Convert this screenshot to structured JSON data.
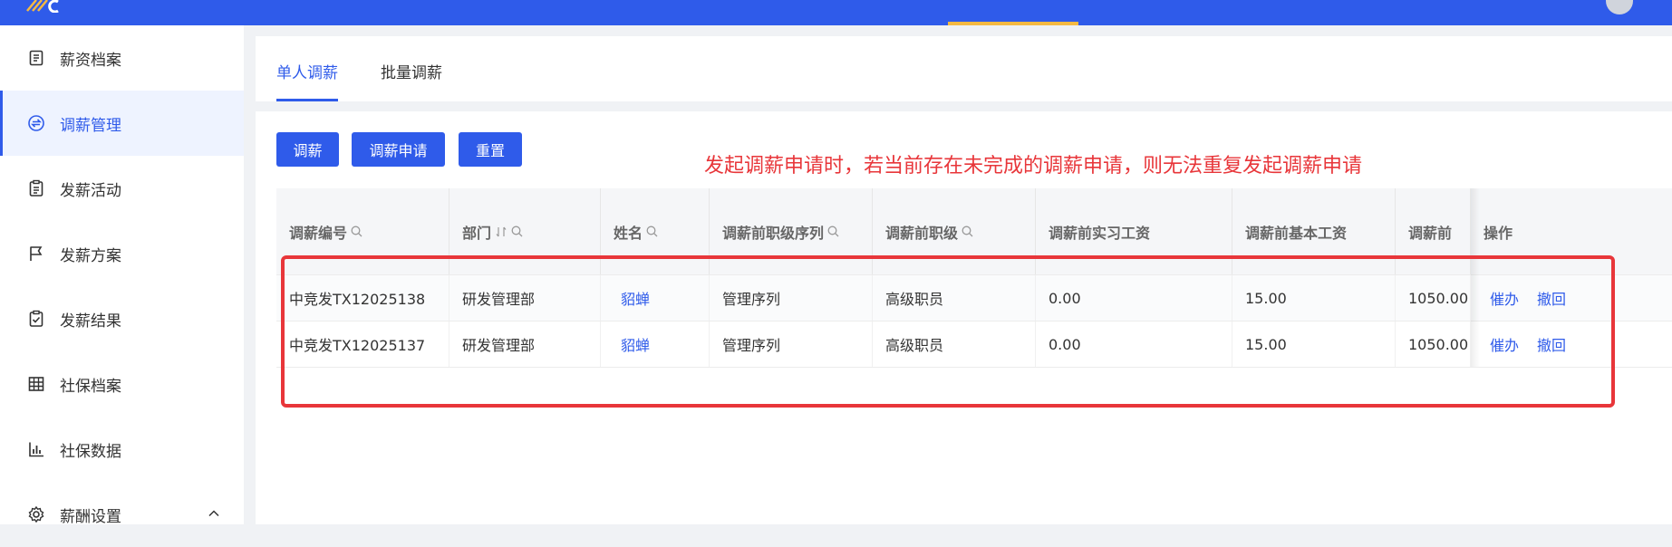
{
  "colors": {
    "brand": "#2f5bea",
    "annotation": "#e8363a",
    "topbar_indicator": "#f5b942"
  },
  "sidebar": {
    "items": [
      {
        "label": "薪资档案",
        "icon": "document-icon"
      },
      {
        "label": "调薪管理",
        "icon": "exchange-icon",
        "active": true
      },
      {
        "label": "发薪活动",
        "icon": "clipboard-icon"
      },
      {
        "label": "发薪方案",
        "icon": "flag-icon"
      },
      {
        "label": "发薪结果",
        "icon": "clipboard-check-icon"
      },
      {
        "label": "社保档案",
        "icon": "columns-icon"
      },
      {
        "label": "社保数据",
        "icon": "bar-chart-icon"
      },
      {
        "label": "薪酬设置",
        "icon": "gear-icon",
        "expandable": true
      }
    ]
  },
  "tabs": [
    {
      "label": "单人调薪",
      "active": true
    },
    {
      "label": "批量调薪"
    }
  ],
  "toolbar": {
    "adjust_label": "调薪",
    "apply_label": "调薪申请",
    "reset_label": "重置"
  },
  "annotation": "发起调薪申请时，若当前存在未完成的调薪申请，则无法重复发起调薪申请",
  "table": {
    "columns": [
      "调薪编号",
      "部门",
      "姓名",
      "调薪前职级序列",
      "调薪前职级",
      "调薪前实习工资",
      "调薪前基本工资",
      "调薪前",
      "操作"
    ],
    "rows": [
      {
        "id": "中竞发TX12025138",
        "dept": "研发管理部",
        "name": "貂蝉",
        "seq": "管理序列",
        "rank": "高级职员",
        "intern": "0.00",
        "base": "15.00",
        "prev": "1050.00",
        "urge": "催办",
        "withdraw": "撤回"
      },
      {
        "id": "中竞发TX12025137",
        "dept": "研发管理部",
        "name": "貂蝉",
        "seq": "管理序列",
        "rank": "高级职员",
        "intern": "0.00",
        "base": "15.00",
        "prev": "1050.00",
        "urge": "催办",
        "withdraw": "撤回"
      }
    ]
  }
}
